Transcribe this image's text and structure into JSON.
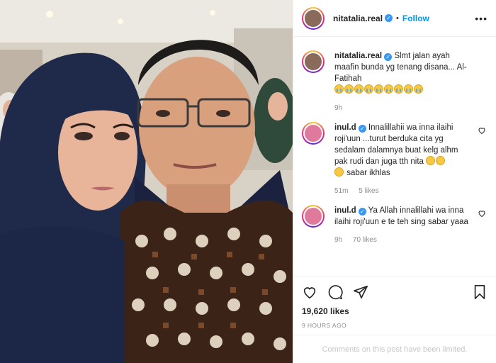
{
  "header": {
    "username": "nitatalia.real",
    "verified_icon": "verified-badge-icon",
    "separator": "•",
    "follow_label": "Follow",
    "more_icon": "more-options-icon"
  },
  "comments": [
    {
      "username": "nitatalia.real",
      "text": "Slmt jalan ayah maafin bunda yg tenang disana... Al-Fatihah",
      "emoji": "crying-face-emoji x9",
      "meta": {
        "time": "9h"
      }
    },
    {
      "username": "inul.d",
      "text": "Innalillahii wa inna ilaihi roji'uun ...turut berduka cita yg sedalam dalamnya buat kelg alhm pak rudi dan juga tth nita",
      "text_tail": "sabar ikhlas",
      "meta": {
        "time": "51m",
        "likes": "5 likes"
      }
    },
    {
      "username": "inul.d",
      "text": "Ya Allah innalillahi wa inna ilaihi roji'uun e te teh sing sabar yaaa",
      "meta": {
        "time": "9h",
        "likes": "70 likes"
      }
    }
  ],
  "actions": {
    "like_icon": "heart-icon",
    "comment_icon": "comment-icon",
    "share_icon": "share-icon",
    "save_icon": "bookmark-icon",
    "likes": "19,620 likes",
    "timestamp": "9 HOURS AGO"
  },
  "footer": {
    "limited_text": "Comments on this post have been limited."
  },
  "colors": {
    "accent": "#0095f6",
    "verified": "#3897f0",
    "muted": "#8e8e8e"
  }
}
